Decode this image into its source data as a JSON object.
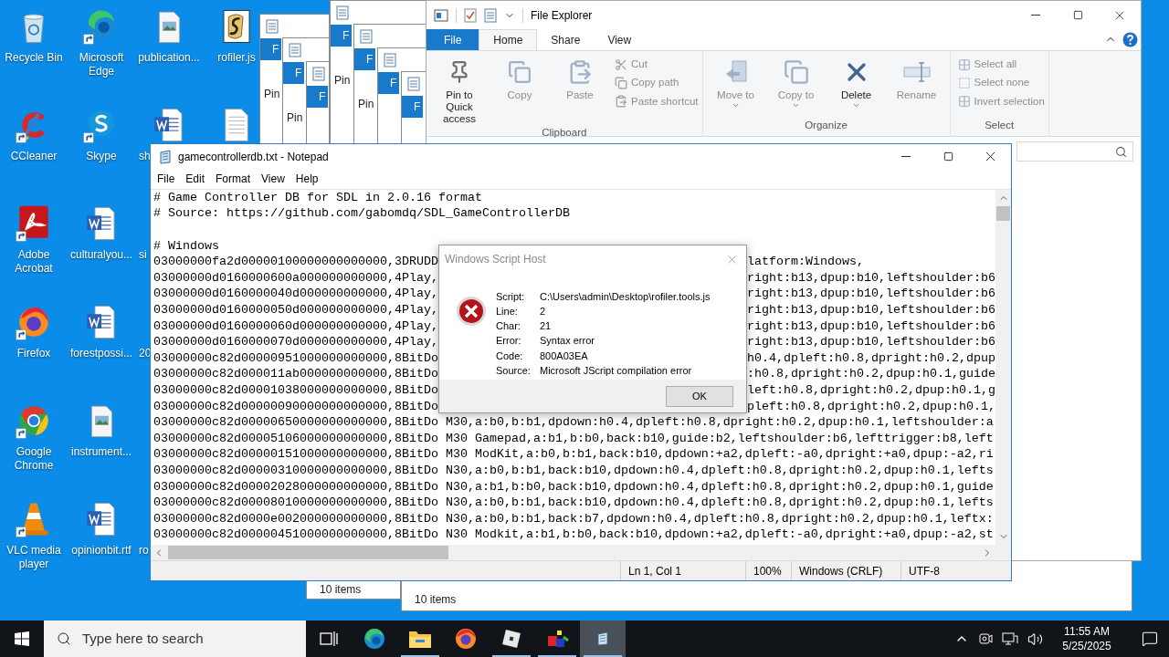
{
  "desktop": {
    "columns": [
      [
        {
          "kind": "recycle",
          "label": "Recycle Bin",
          "shortcut": false
        },
        {
          "kind": "ccleaner",
          "label": "CCleaner",
          "shortcut": true
        },
        {
          "kind": "acrobat",
          "label": "Adobe Acrobat",
          "shortcut": true
        },
        {
          "kind": "firefox",
          "label": "Firefox",
          "shortcut": true
        },
        {
          "kind": "chrome",
          "label": "Google Chrome",
          "shortcut": true
        },
        {
          "kind": "vlc",
          "label": "VLC media player",
          "shortcut": true
        }
      ],
      [
        {
          "kind": "edge",
          "label": "Microsoft Edge",
          "shortcut": true
        },
        {
          "kind": "skype",
          "label": "Skype",
          "shortcut": true
        },
        {
          "kind": "word",
          "label": "culturalyou...",
          "shortcut": false
        },
        {
          "kind": "word",
          "label": "forestpossi...",
          "shortcut": false
        },
        {
          "kind": "image",
          "label": "instrument...",
          "shortcut": false
        },
        {
          "kind": "word",
          "label": "opinionbit.rtf",
          "shortcut": false
        }
      ],
      [
        {
          "kind": "image",
          "label": "publication...",
          "shortcut": false
        },
        {
          "kind": "word",
          "label": "sh",
          "shortcut": false,
          "cut": true
        },
        {
          "kind": "none",
          "label": "si",
          "cut": true
        },
        {
          "kind": "none",
          "label": "20",
          "cut": true
        },
        {
          "kind": "none"
        },
        {
          "kind": "none",
          "label": "ro",
          "cut": true
        }
      ],
      [
        {
          "kind": "script",
          "label": "rofiler.js",
          "shortcut": false
        },
        {
          "kind": "text",
          "shortcut": false
        }
      ]
    ]
  },
  "background_windows": [
    {
      "tab": "F",
      "button": "Pin"
    },
    {
      "tab": "F",
      "button": "Pin"
    },
    {
      "tab": "F"
    },
    {
      "tab": "F",
      "button": "Pin"
    },
    {
      "tab": "F",
      "button": "Pin"
    },
    {
      "tab": "F"
    },
    {
      "tab": "F",
      "status": "10 items"
    }
  ],
  "covered_window": {
    "status": "10 items"
  },
  "explorer": {
    "title": "File Explorer",
    "tabs": [
      {
        "label": "File",
        "kind": "file",
        "selected": false
      },
      {
        "label": "Home",
        "kind": "tab",
        "selected": true
      },
      {
        "label": "Share",
        "kind": "tab",
        "selected": false
      },
      {
        "label": "View",
        "kind": "tab",
        "selected": false
      }
    ],
    "groups": [
      {
        "label": "Clipboard",
        "large": [
          {
            "label": "Pin to Quick access",
            "disabled": false
          },
          {
            "label": "Copy",
            "disabled": true
          },
          {
            "label": "Paste",
            "disabled": true
          }
        ],
        "small": [
          {
            "label": "Cut",
            "disabled": true
          },
          {
            "label": "Copy path",
            "disabled": true
          },
          {
            "label": "Paste shortcut",
            "disabled": true
          }
        ]
      },
      {
        "label": "Organize",
        "large": [
          {
            "label": "Move to",
            "disabled": true,
            "dropdown": true
          },
          {
            "label": "Copy to",
            "disabled": true,
            "dropdown": true
          },
          {
            "label": "Delete",
            "disabled": false,
            "dropdown": true
          },
          {
            "label": "Rename",
            "disabled": true,
            "dropdown": false
          }
        ]
      },
      {
        "label": "Select",
        "small": [
          {
            "label": "Select all",
            "disabled": true
          },
          {
            "label": "Select none",
            "disabled": true
          },
          {
            "label": "Invert selection",
            "disabled": true
          }
        ]
      }
    ]
  },
  "notepad": {
    "title": "gamecontrollerdb.txt - Notepad",
    "menu": [
      "File",
      "Edit",
      "Format",
      "View",
      "Help"
    ],
    "lines": [
      {
        "kind": "full",
        "text": "# Game Controller DB for SDL in 2.0.16 format"
      },
      {
        "kind": "full",
        "text": "# Source: https://github.com/gabomdq/SDL_GameControllerDB"
      },
      {
        "kind": "blank"
      },
      {
        "kind": "full",
        "text": "# Windows"
      },
      {
        "kind": "split",
        "left": "03000000fa2d00000100000000000000,3DRUDD",
        "right": "latform:Windows,"
      },
      {
        "kind": "split",
        "left": "03000000d0160000600a000000000000,4Play,",
        "right": "right:b13,dpup:b10,leftshoulder:b6"
      },
      {
        "kind": "split",
        "left": "03000000d0160000040d000000000000,4Play,",
        "right": "right:b13,dpup:b10,leftshoulder:b6"
      },
      {
        "kind": "split",
        "left": "03000000d0160000050d000000000000,4Play,",
        "right": "right:b13,dpup:b10,leftshoulder:b6"
      },
      {
        "kind": "split",
        "left": "03000000d0160000060d000000000000,4Play,",
        "right": "right:b13,dpup:b10,leftshoulder:b6"
      },
      {
        "kind": "split",
        "left": "03000000d0160000070d000000000000,4Play,",
        "right": "right:b13,dpup:b10,leftshoulder:b6"
      },
      {
        "kind": "split",
        "left": "03000000c82d00000951000000000000,8BitDo",
        "right": "h0.4,dpleft:h0.8,dpright:h0.2,dpup"
      },
      {
        "kind": "split",
        "left": "03000000c82d000011ab000000000000,8BitDo",
        "right": ":h0.8,dpright:h0.2,dpup:h0.1,guide"
      },
      {
        "kind": "split",
        "left": "03000000c82d00001038000000000000,8BitDo",
        "right": "left:h0.8,dpright:h0.2,dpup:h0.1,g"
      },
      {
        "kind": "split",
        "left": "03000000c82d00000090000000000000,8BitDo",
        "right": "pleft:h0.8,dpright:h0.2,dpup:h0.1,"
      },
      {
        "kind": "full",
        "text": "03000000c82d00000650000000000000,8BitDo M30,a:b0,b:b1,dpdown:h0.4,dpleft:h0.8,dpright:h0.2,dpup:h0.1,leftshoulder:a"
      },
      {
        "kind": "full",
        "text": "03000000c82d00005106000000000000,8BitDo M30 Gamepad,a:b1,b:b0,back:b10,guide:b2,leftshoulder:b6,lefttrigger:b8,left"
      },
      {
        "kind": "full",
        "text": "03000000c82d00000151000000000000,8BitDo M30 ModKit,a:b0,b:b1,back:b10,dpdown:+a2,dpleft:-a0,dpright:+a0,dpup:-a2,ri"
      },
      {
        "kind": "full",
        "text": "03000000c82d00000310000000000000,8BitDo N30,a:b0,b:b1,back:b10,dpdown:h0.4,dpleft:h0.8,dpright:h0.2,dpup:h0.1,lefts"
      },
      {
        "kind": "full",
        "text": "03000000c82d00002028000000000000,8BitDo N30,a:b1,b:b0,back:b10,dpdown:h0.4,dpleft:h0.8,dpright:h0.2,dpup:h0.1,guide"
      },
      {
        "kind": "full",
        "text": "03000000c82d00008010000000000000,8BitDo N30,a:b0,b:b1,back:b10,dpdown:h0.4,dpleft:h0.8,dpright:h0.2,dpup:h0.1,lefts"
      },
      {
        "kind": "full",
        "text": "03000000c82d0000e002000000000000,8BitDo N30,a:b0,b:b1,back:b7,dpdown:h0.4,dpleft:h0.8,dpright:h0.2,dpup:h0.1,leftx:"
      },
      {
        "kind": "full",
        "text": "03000000c82d00000451000000000000,8BitDo N30 Modkit,a:b1,b:b0,back:b10,dpdown:+a2,dpleft:-a0,dpright:+a0,dpup:-a2,st"
      }
    ],
    "status": [
      "Ln 1, Col 1",
      "100%",
      "Windows (CRLF)",
      "UTF-8"
    ]
  },
  "dialog": {
    "title": "Windows Script Host",
    "fields": [
      {
        "label": "Script:",
        "value": "C:\\Users\\admin\\Desktop\\rofiler.tools.js"
      },
      {
        "label": "Line:",
        "value": "2"
      },
      {
        "label": "Char:",
        "value": "21"
      },
      {
        "label": "Error:",
        "value": "Syntax error"
      },
      {
        "label": "Code:",
        "value": "800A03EA"
      },
      {
        "label": "Source:",
        "value": "Microsoft JScript compilation error"
      }
    ],
    "button": "OK"
  },
  "taskbar": {
    "search": {
      "placeholder": "Type here to search"
    },
    "apps": [
      {
        "kind": "edge",
        "running": false,
        "selected": false
      },
      {
        "kind": "explorer",
        "running": true,
        "selected": false
      },
      {
        "kind": "firefox",
        "running": false,
        "selected": false
      },
      {
        "kind": "cube",
        "running": true,
        "selected": false
      },
      {
        "kind": "paint",
        "running": true,
        "selected": false
      },
      {
        "kind": "notepad",
        "running": true,
        "selected": true
      }
    ],
    "time": "11:55 AM",
    "date": "5/25/2025"
  }
}
